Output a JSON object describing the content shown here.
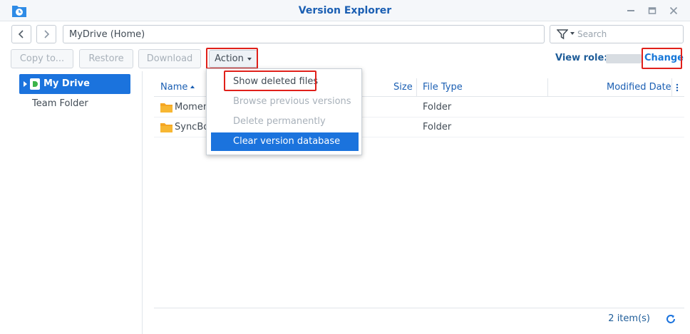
{
  "window": {
    "title": "Version Explorer"
  },
  "nav": {
    "path": "MyDrive (Home)"
  },
  "search": {
    "placeholder": "Search"
  },
  "toolbar": {
    "copy_to": "Copy to...",
    "restore": "Restore",
    "download": "Download",
    "action": "Action",
    "view_role_label": "View role:",
    "change": "Change"
  },
  "action_menu": {
    "items": [
      {
        "label": "Show deleted files",
        "state": "enabled"
      },
      {
        "label": "Browse previous versions",
        "state": "disabled"
      },
      {
        "label": "Delete permanently",
        "state": "disabled"
      },
      {
        "label": "Clear version database",
        "state": "highlighted"
      }
    ]
  },
  "tree": {
    "items": [
      {
        "label": "My Drive",
        "selected": true
      },
      {
        "label": "Team Folder",
        "selected": false
      }
    ]
  },
  "grid": {
    "columns": [
      "Name",
      "Size",
      "File Type",
      "Modified Date"
    ],
    "sort_column": "Name",
    "rows": [
      {
        "name": "Momen",
        "file_type": "Folder"
      },
      {
        "name": "SyncBo",
        "file_type": "Folder"
      }
    ],
    "item_count": "2 item(s)"
  },
  "colors": {
    "accent": "#1b73dd",
    "title_text": "#1b5fb3",
    "highlight_box": "#e0201a",
    "folder": "#f5a623"
  }
}
